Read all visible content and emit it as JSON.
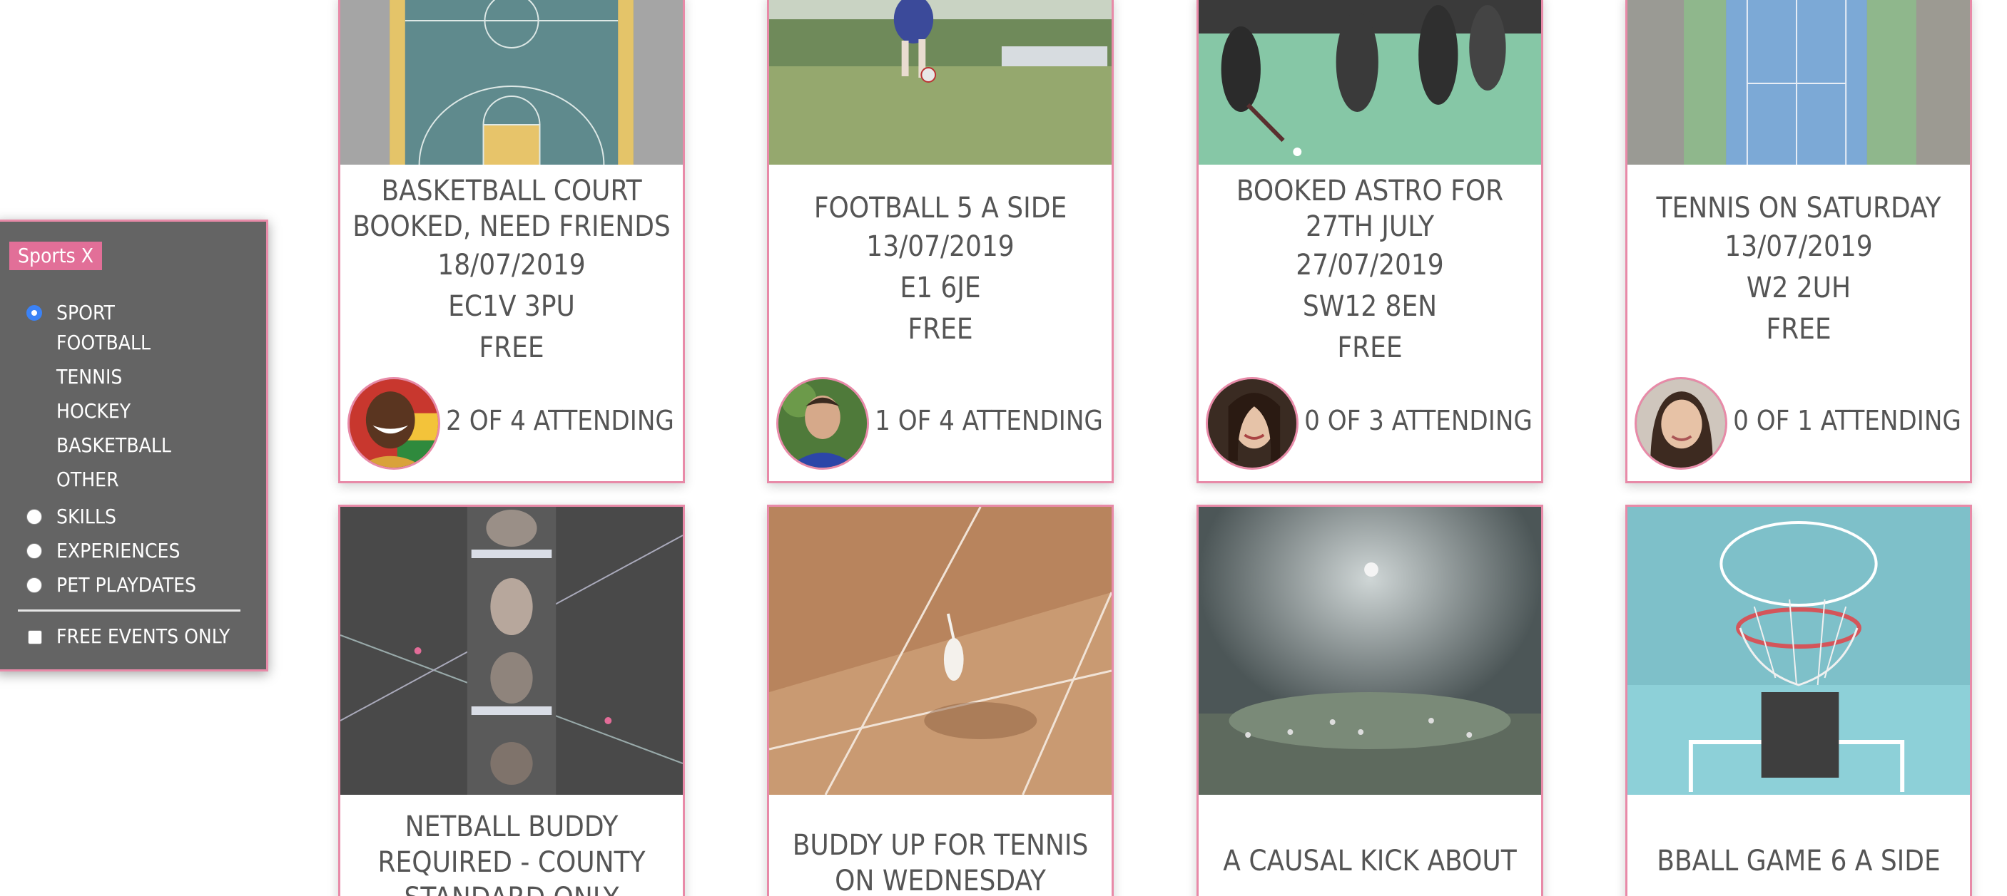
{
  "filters": {
    "brand": "Sports X",
    "categories": [
      {
        "label": "SPORT",
        "selected": true
      },
      {
        "label": "SKILLS",
        "selected": false
      },
      {
        "label": "EXPERIENCES",
        "selected": false
      },
      {
        "label": "PET PLAYDATES",
        "selected": false
      }
    ],
    "sport_subcategories": [
      "FOOTBALL",
      "TENNIS",
      "HOCKEY",
      "BASKETBALL",
      "OTHER"
    ],
    "free_only": {
      "label": "FREE EVENTS ONLY",
      "checked": false
    }
  },
  "events": [
    {
      "title": "BASKETBALL COURT BOOKED, NEED FRIENDS",
      "date": "18/07/2019",
      "postcode": "EC1V 3PU",
      "price": "FREE",
      "attending": "2 OF 4 ATTENDING",
      "photo": "basketball-court-photo"
    },
    {
      "title": "FOOTBALL 5 A SIDE",
      "date": "13/07/2019",
      "postcode": "E1 6JE",
      "price": "FREE",
      "attending": "1 OF 4 ATTENDING",
      "photo": "football-photo"
    },
    {
      "title": "BOOKED ASTRO FOR 27TH JULY",
      "date": "27/07/2019",
      "postcode": "SW12 8EN",
      "price": "FREE",
      "attending": "0 OF 3 ATTENDING",
      "photo": "hockey-photo"
    },
    {
      "title": "TENNIS ON SATURDAY",
      "date": "13/07/2019",
      "postcode": "W2 2UH",
      "price": "FREE",
      "attending": "0 OF 1 ATTENDING",
      "photo": "tennis-court-photo"
    },
    {
      "title": "NETBALL BUDDY REQUIRED - COUNTY STANDARD ONLY",
      "photo": "rowing-photo"
    },
    {
      "title": "BUDDY UP FOR TENNIS ON WEDNESDAY",
      "photo": "clay-tennis-photo"
    },
    {
      "title": "A CAUSAL KICK ABOUT",
      "photo": "night-football-photo"
    },
    {
      "title": "BBALL GAME 6 A SIDE",
      "photo": "basketball-hoop-photo"
    }
  ]
}
